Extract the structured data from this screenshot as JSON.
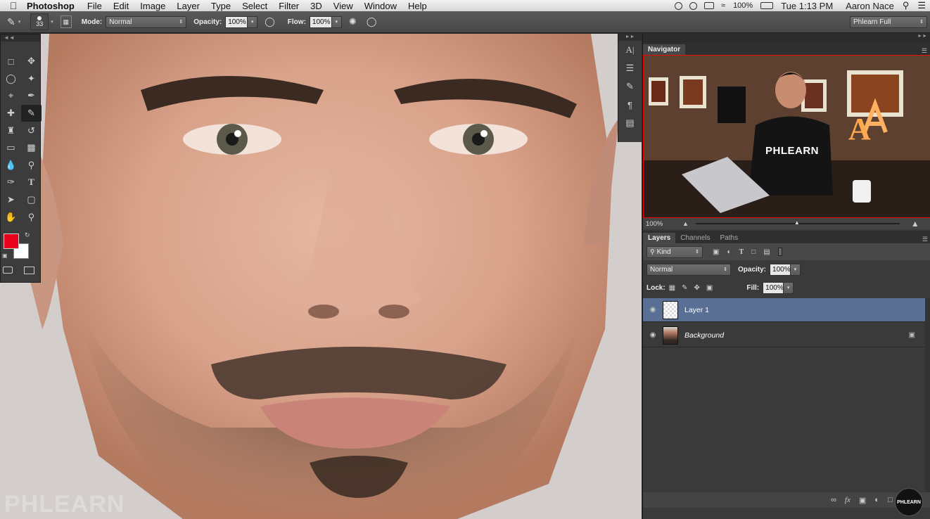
{
  "menubar": {
    "app_name": "Photoshop",
    "menus": [
      "File",
      "Edit",
      "Image",
      "Layer",
      "Type",
      "Select",
      "Filter",
      "3D",
      "View",
      "Window",
      "Help"
    ],
    "status": {
      "battery": "100%",
      "clock": "Tue 1:13 PM",
      "user": "Aaron Nace"
    }
  },
  "options_bar": {
    "brush_size": "33",
    "mode_label": "Mode:",
    "mode_value": "Normal",
    "opacity_label": "Opacity:",
    "opacity_value": "100%",
    "flow_label": "Flow:",
    "flow_value": "100%",
    "workspace": "Phlearn Full"
  },
  "navigator": {
    "title": "Navigator",
    "zoom": "100%",
    "shirt_text": "PHLEARN",
    "sign_letter": "A"
  },
  "layers_panel": {
    "tabs": [
      "Layers",
      "Channels",
      "Paths"
    ],
    "filter_kind": "Kind",
    "blend_mode": "Normal",
    "opacity_label": "Opacity:",
    "opacity_value": "100%",
    "lock_label": "Lock:",
    "fill_label": "Fill:",
    "fill_value": "100%",
    "layers": [
      {
        "name": "Layer 1"
      },
      {
        "name": "Background"
      }
    ]
  },
  "watermark": "PHLEARN",
  "badge": "PHLEARN",
  "colors": {
    "foreground": "#e8001c",
    "background": "#ffffff",
    "selected_layer": "#5a6f94"
  }
}
